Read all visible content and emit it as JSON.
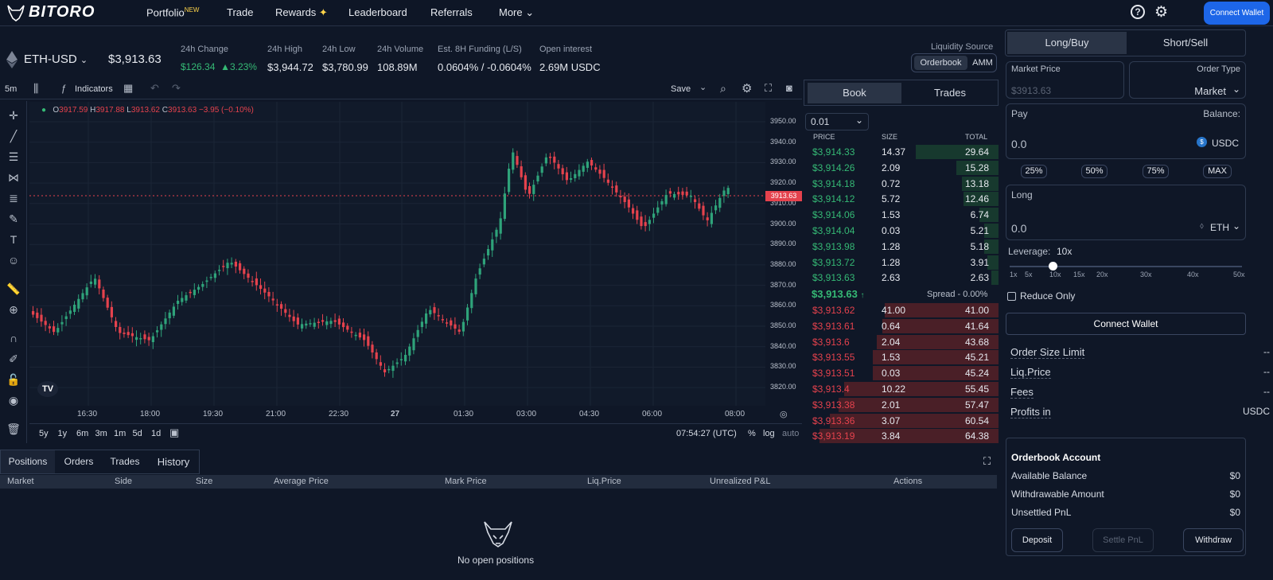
{
  "nav": {
    "logo": "BITORO",
    "items": [
      "Portfolio",
      "Trade",
      "Rewards",
      "Leaderboard",
      "Referrals",
      "More"
    ],
    "portfolio_badge": "NEW",
    "connect_label": "Connect Wallet"
  },
  "ticker": {
    "symbol": "ETH-USD",
    "price": "$3,913.63",
    "stats": [
      {
        "label": "24h Change",
        "value": "$126.34",
        "extra": "▲3.23%"
      },
      {
        "label": "24h High",
        "value": "$3,944.72"
      },
      {
        "label": "24h Low",
        "value": "$3,780.99"
      },
      {
        "label": "24h Volume",
        "value": "108.89M"
      },
      {
        "label": "Est. 8H Funding (L/S)",
        "value": "0.0604% / -0.0604%"
      },
      {
        "label": "Open interest",
        "value": "2.69M USDC"
      }
    ],
    "liquidity_label": "Liquidity Source",
    "liquidity_options": [
      "Orderbook",
      "AMM"
    ]
  },
  "toolbar": {
    "interval": "5m",
    "indicators": "Indicators",
    "save": "Save"
  },
  "chart": {
    "ohlc_o": "O",
    "ohlc_o_val": "3917.59",
    "ohlc_h": "H",
    "ohlc_h_val": "3917.88",
    "ohlc_l": "L",
    "ohlc_l_val": "3913.62",
    "ohlc_c": "C",
    "ohlc_c_val": "3913.63",
    "ohlc_chg": "−3.95 (−0.10%)",
    "price_tag": "3913.63",
    "y_ticks": [
      "3950.00",
      "3940.00",
      "3930.00",
      "3920.00",
      "3910.00",
      "3900.00",
      "3890.00",
      "3880.00",
      "3870.00",
      "3860.00",
      "3850.00",
      "3840.00",
      "3830.00",
      "3820.00"
    ],
    "x_ticks": [
      "16:30",
      "18:00",
      "19:30",
      "21:00",
      "22:30",
      "27",
      "01:30",
      "03:00",
      "04:30",
      "06:00",
      "08:00"
    ],
    "ranges": [
      "5y",
      "1y",
      "6m",
      "3m",
      "1m",
      "5d",
      "1d"
    ],
    "time": "07:54:27 (UTC)",
    "opts": [
      "%",
      "log",
      "auto"
    ]
  },
  "orderbook": {
    "tabs": [
      "Book",
      "Trades"
    ],
    "tick": "0.01",
    "headers": [
      "PRICE",
      "SIZE",
      "TOTAL"
    ],
    "bids": [
      [
        "$3,914.33",
        "14.37",
        "29.64"
      ],
      [
        "$3,914.26",
        "2.09",
        "15.28"
      ],
      [
        "$3,914.18",
        "0.72",
        "13.18"
      ],
      [
        "$3,914.12",
        "5.72",
        "12.46"
      ],
      [
        "$3,914.06",
        "1.53",
        "6.74"
      ],
      [
        "$3,914.04",
        "0.03",
        "5.21"
      ],
      [
        "$3,913.98",
        "1.28",
        "5.18"
      ],
      [
        "$3,913.72",
        "1.28",
        "3.91"
      ],
      [
        "$3,913.63",
        "2.63",
        "2.63"
      ]
    ],
    "mid": "$3,913.63",
    "spread": "Spread - 0.00%",
    "asks": [
      [
        "$3,913.62",
        "41.00",
        "41.00"
      ],
      [
        "$3,913.61",
        "0.64",
        "41.64"
      ],
      [
        "$3,913.6",
        "2.04",
        "43.68"
      ],
      [
        "$3,913.55",
        "1.53",
        "45.21"
      ],
      [
        "$3,913.51",
        "0.03",
        "45.24"
      ],
      [
        "$3,913.4",
        "10.22",
        "55.45"
      ],
      [
        "$3,913.38",
        "2.01",
        "57.47"
      ],
      [
        "$3,913.36",
        "3.07",
        "60.54"
      ],
      [
        "$3,913.19",
        "3.84",
        "64.38"
      ]
    ]
  },
  "positions": {
    "tabs": [
      "Positions",
      "Orders",
      "Trades",
      "History"
    ],
    "columns": [
      "Market",
      "Side",
      "Size",
      "Average Price",
      "Mark Price",
      "Liq.Price",
      "Unrealized P&L",
      "Actions"
    ],
    "empty": "No open positions"
  },
  "order_form": {
    "tabs": [
      "Long/Buy",
      "Short/Sell"
    ],
    "market_price_label": "Market Price",
    "market_price_placeholder": "$3913.63",
    "order_type_label": "Order Type",
    "order_type_value": "Market",
    "pay_label": "Pay",
    "balance_label": "Balance:",
    "pay_value": "0.0",
    "pay_token": "USDC",
    "pct": [
      "25%",
      "50%",
      "75%",
      "MAX"
    ],
    "long_label": "Long",
    "long_value": "0.0",
    "long_token": "ETH",
    "leverage_label": "Leverage:",
    "leverage_value": "10x",
    "leverage_marks": [
      "1x",
      "5x",
      "10x",
      "15x",
      "20x",
      "30x",
      "40x",
      "50x"
    ],
    "reduce_only": "Reduce Only",
    "connect": "Connect Wallet",
    "info": [
      [
        "Order Size Limit",
        "--"
      ],
      [
        "Liq.Price",
        "--"
      ],
      [
        "Fees",
        "--"
      ],
      [
        "Profits in",
        "USDC"
      ]
    ],
    "account_title": "Orderbook Account",
    "account": [
      [
        "Available Balance",
        "$0"
      ],
      [
        "Withdrawable Amount",
        "$0"
      ],
      [
        "Unsettled PnL",
        "$0"
      ]
    ],
    "actions": [
      "Deposit",
      "Settle PnL",
      "Withdraw"
    ]
  }
}
